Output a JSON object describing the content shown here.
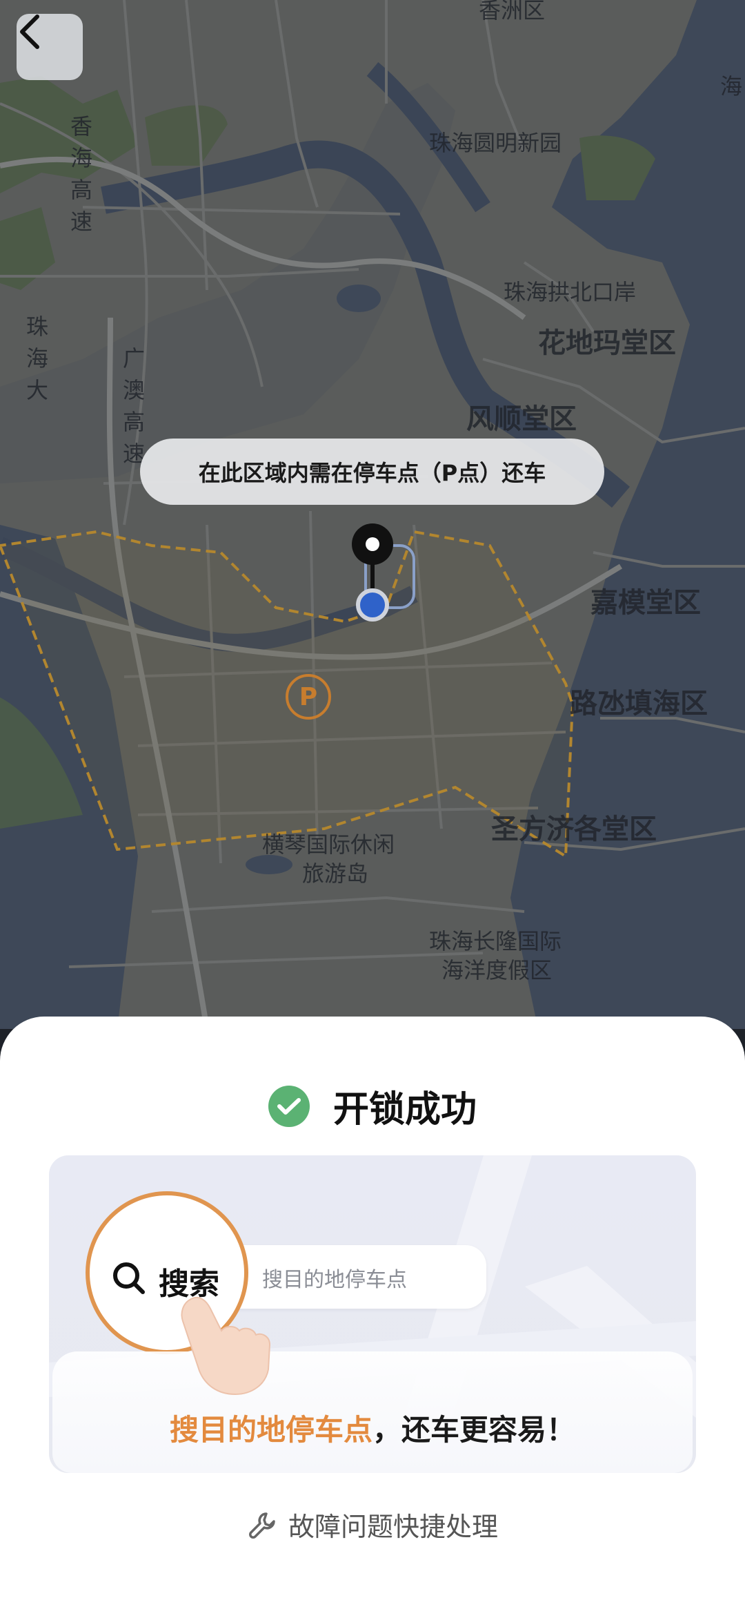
{
  "map": {
    "back_icon": "chevron-left-icon",
    "banner_text": "在此区域内需在停车点（P点）还车",
    "parking_symbol": "P",
    "places": {
      "yuanming": "珠海圆明新园",
      "gongbei": "珠海拱北口岸",
      "huadima": "花地玛堂区",
      "fengshun": "风顺堂区",
      "jiamo": "嘉模堂区",
      "ludanghai": "路氹填海区",
      "shengfangji": "圣方济各堂区",
      "hengqin1": "横琴国际休闲",
      "hengqin2": "旅游岛",
      "changlong1": "珠海长隆国际",
      "changlong2": "海洋度假区",
      "top_cut": "香洲区",
      "top_right": "海",
      "road_left1": "香海高速",
      "road_left2": "珠海大",
      "road_gaoao": "广澳高速"
    }
  },
  "sheet": {
    "status_icon": "check-circle-icon",
    "title": "开锁成功",
    "promo": {
      "search_label": "搜索",
      "search_placeholder": "搜目的地停车点",
      "caption_highlight": "搜目的地停车点",
      "caption_rest": "，还车更容易！"
    },
    "help_icon": "wrench-icon",
    "help_text": "故障问题快捷处理"
  },
  "colors": {
    "accent_orange": "#e38a3e",
    "success_green": "#5bb273",
    "location_blue": "#2f62c9"
  }
}
